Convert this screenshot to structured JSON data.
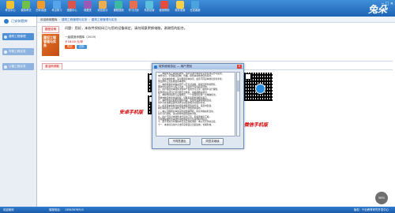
{
  "toolbar": {
    "items": [
      {
        "label": "考试中心",
        "color": "#f1c232"
      },
      {
        "label": "模拟考试",
        "color": "#6fbf4a"
      },
      {
        "label": "历年真题",
        "color": "#f39b29"
      },
      {
        "label": "考点练习",
        "color": "#56a5ec"
      },
      {
        "label": "错题中心",
        "color": "#d9534f"
      },
      {
        "label": "收藏夹",
        "color": "#9b59b6"
      },
      {
        "label": "成绩统计",
        "color": "#f0ad4e"
      },
      {
        "label": "课程视频",
        "color": "#3bb9a3"
      },
      {
        "label": "学习计划",
        "color": "#e76f51"
      },
      {
        "label": "系统设置",
        "color": "#5bc0de"
      },
      {
        "label": "使用帮助",
        "color": "#e64b3c"
      },
      {
        "label": "软件更新",
        "color": "#f7d046"
      },
      {
        "label": "在线客服",
        "color": "#4aa3df"
      }
    ],
    "brand": "兔朵",
    "window_controls": "─ □ ✕"
  },
  "left": {
    "header": "已安装题库",
    "items": [
      "建筑工程管理",
      "市政工程实务",
      "公路工程实务"
    ]
  },
  "breadcrumb": {
    "root": "欢迎使用题库",
    "crumb1": "建筑工程管理与实务",
    "crumb2": "建筑工程管理与实务"
  },
  "chip_top": "题型说明",
  "question": "问题：您好，本软件授权码已与您的设备绑定，请勿随意更换电脑，谢谢您的配合。",
  "book": {
    "cover": "建设工程管理与实务",
    "title": "一级建造师题库（2019）",
    "price": "￥18.00 元/年",
    "buy_label": "购买",
    "trial_label": "试用"
  },
  "chip_bottom": "激活码领取",
  "caption_left": "安卓手机版",
  "caption_right": "微信手机版",
  "modal": {
    "title": "软件使用协议 — 用户须知",
    "close": "✕",
    "lines": [
      "一、本软件为正版授权软件，用户须遵守本协议全部条款后方可使用，",
      "    未经许可，不得擅自复制、传播、转售本软件的任何部分。",
      "二、使用本软件前，请仔细阅读本协议，如您不同意本协议任何条款，",
      "    请立即停止安装或使用本软件。",
      "三、本软件题库内容来源于公开考试资料，版权归原作者所有，",
      "    本软件仅提供学习练习之用，不得用于任何商业目的。",
      "四、用户在使用本软件过程中产生的学习记录，由用户自行保管，",
      "    软件更新后部分记录可能无法恢复，请提前做好备份。",
      "五、本软件授权码与设备绑定，一个授权码仅限一台电脑使用，",
      "    更换电脑需重新申请授权，请联系客服处理相关事宜。",
      "六、本软件会定期更新题库内容，更新时需保持网络连接，",
      "    用户可在系统设置中选择自动更新或手动更新方式。",
      "七、如发现本软件存在错误或题目答案有误，请及时反馈，",
      "    我们将在核实后尽快修正并在下次更新中发布。",
      "八、本公司保留对本协议的最终解释权，协议内容如有变动，",
      "    恕不另行通知，请以软件内最新版本为准。",
      "九、用户不得对本软件进行反向工程、反编译或反汇编，",
      "    不得删除或修改本软件中的版权信息及其他权利标识。",
      "十、因不可抗力导致软件无法正常使用的，本公司不承担责任。",
      "十一、本协议自用户点击同意按钮之日起生效，长期有效。"
    ],
    "btn_agree": "不同意退出",
    "btn_cancel": "同意并继续"
  },
  "status": {
    "left": "欢迎使用",
    "phone_label": "客服电话：",
    "phone": "13845678910",
    "right": "版权：兴业教育研究开发中心"
  },
  "zoom": "58%"
}
